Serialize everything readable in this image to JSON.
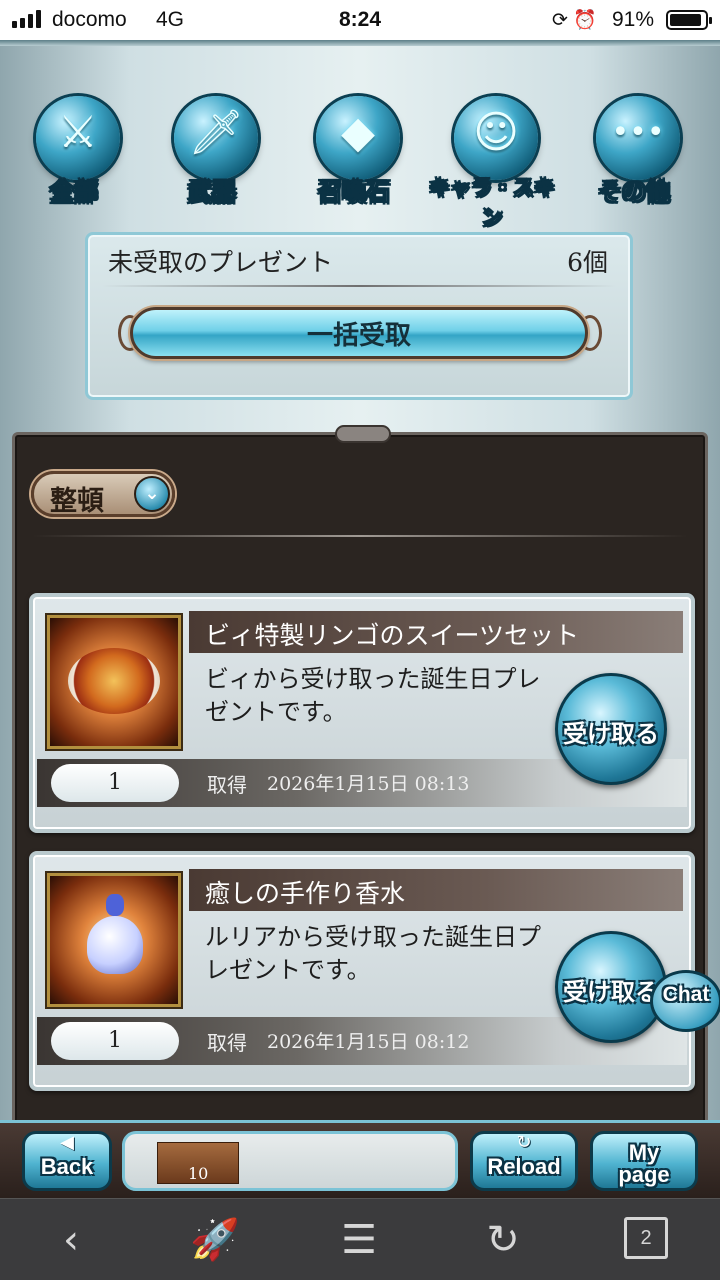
{
  "status_bar": {
    "carrier": "docomo",
    "network": "4G",
    "time": "8:24",
    "battery_percent": "91%",
    "battery_level": 0.91
  },
  "categories": [
    {
      "label": "全部",
      "icon": "sword-shield-icon",
      "glyph": "⚔"
    },
    {
      "label": "武器",
      "icon": "sword-icon",
      "glyph": "🗡"
    },
    {
      "label": "召喚石",
      "icon": "crystal-icon",
      "glyph": "◆"
    },
    {
      "label": "キャラ・スキン",
      "icon": "character-icon",
      "glyph": "☺"
    },
    {
      "label": "その他",
      "icon": "more-icon",
      "glyph": "•••"
    }
  ],
  "unclaimed": {
    "label": "未受取のプレゼント",
    "count": "6個",
    "claim_all_label": "一括受取"
  },
  "sort": {
    "label": "整頓",
    "icon": "chevron-down-icon",
    "glyph": "⌄"
  },
  "presents": [
    {
      "title": "ビィ特製リンゴのスイーツセット",
      "description": "ビィから受け取った誕生日プレゼントです。",
      "claim_label": "受け取る",
      "quantity": "1",
      "obtained_label": "取得",
      "obtained_at": "2026年1月15日 08:13",
      "thumbnail": "apple-sweets-set-image"
    },
    {
      "title": "癒しの手作り香水",
      "description": "ルリアから受け取った誕生日プレゼントです。",
      "claim_label": "受け取る",
      "quantity": "1",
      "obtained_label": "取得",
      "obtained_at": "2026年1月15日 08:12",
      "thumbnail": "perfume-bottle-image"
    }
  ],
  "chat": {
    "label": "Chat"
  },
  "game_nav": {
    "back_label": "Back",
    "reload_label": "Reload",
    "mypage_label": "My page",
    "item_count": "10"
  },
  "browser_toolbar": {
    "tab_count": "2"
  }
}
